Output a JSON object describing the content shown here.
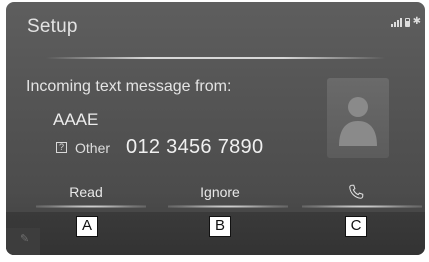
{
  "screen": {
    "title": "Setup"
  },
  "status_bar": {
    "icons": [
      "signal-icon",
      "battery-icon",
      "bluetooth-icon"
    ]
  },
  "message": {
    "label": "Incoming text message from:",
    "sender_name": "AAAE",
    "phone_type_icon": "?",
    "phone_type": "Other",
    "phone_number": "012 3456 7890"
  },
  "avatar": {
    "icon": "contact-silhouette-icon"
  },
  "actions": {
    "read_label": "Read",
    "ignore_label": "Ignore",
    "call_icon": "phone-handset-icon"
  },
  "callouts": {
    "a": "A",
    "b": "B",
    "c": "C"
  },
  "colors": {
    "screen_bg": "#555555",
    "text": "#e6e6e6",
    "callout_bg": "#ffffff",
    "callout_border": "#111111"
  }
}
